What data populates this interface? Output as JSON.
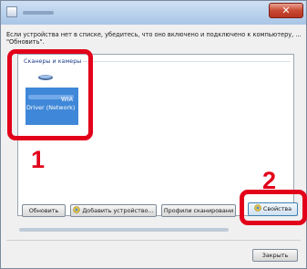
{
  "window": {
    "close_glyph": "✕"
  },
  "prompt_text": "Если устройства нет в списке, убедитесь, что оно включено и подключено к компьютеру, ... \"Обновить\".",
  "device_list": {
    "group_label": "Сканеры и камеры",
    "device_name_line1": "WIA",
    "device_name_line2": "Driver (Network)"
  },
  "buttons": {
    "refresh": "Обновить",
    "add_device": "Добавить устройство...",
    "scan_profiles": "Профили сканировани",
    "properties": "Свойства",
    "close": "Закрыть"
  },
  "callouts": {
    "step1": "1",
    "step2": "2",
    "color": "#e2001a"
  },
  "colors": {
    "selected_tile": "#3f87d8",
    "title_bar": "#b9d1ec",
    "close_button": "#c94a33"
  }
}
